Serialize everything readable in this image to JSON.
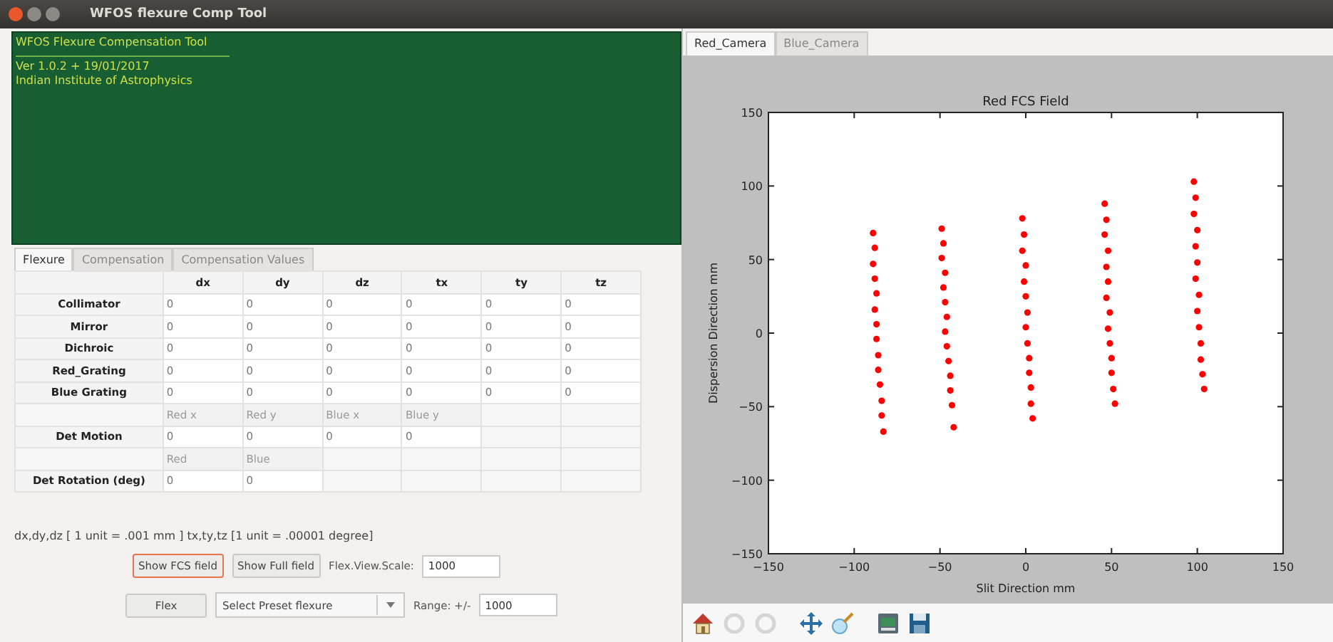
{
  "window": {
    "title": "WFOS flexure Comp Tool",
    "controls": [
      {
        "kind": "close"
      },
      {
        "kind": "minimize"
      },
      {
        "kind": "maximize"
      }
    ]
  },
  "banner": {
    "title": "WFOS Flexure Compensation Tool",
    "lines": [
      "Ver 1.0.2 + 19/01/2017",
      "Indian Institute of Astrophysics"
    ]
  },
  "left_tabs": [
    {
      "label": "Flexure",
      "selected": true
    },
    {
      "label": "Compensation",
      "selected": false
    },
    {
      "label": "Compensation Values",
      "selected": false
    }
  ],
  "table": {
    "columns": [
      "dx",
      "dy",
      "dz",
      "tx",
      "ty",
      "tz"
    ],
    "rows": [
      {
        "kind": "data",
        "label": "Collimator",
        "cells": [
          "0",
          "0",
          "0",
          "0",
          "0",
          "0"
        ]
      },
      {
        "kind": "data",
        "label": "Mirror",
        "cells": [
          "0",
          "0",
          "0",
          "0",
          "0",
          "0"
        ]
      },
      {
        "kind": "data",
        "label": "Dichroic",
        "cells": [
          "0",
          "0",
          "0",
          "0",
          "0",
          "0"
        ]
      },
      {
        "kind": "data",
        "label": "Red_Grating",
        "cells": [
          "0",
          "0",
          "0",
          "0",
          "0",
          "0"
        ]
      },
      {
        "kind": "data",
        "label": "Blue Grating",
        "cells": [
          "0",
          "0",
          "0",
          "0",
          "0",
          "0"
        ]
      },
      {
        "kind": "subheader",
        "cells": [
          "Red x",
          "Red y",
          "Blue x",
          "Blue y"
        ]
      },
      {
        "kind": "data",
        "label": "Det Motion",
        "cells": [
          "0",
          "0",
          "0",
          "0"
        ]
      },
      {
        "kind": "subheader",
        "cells": [
          "Red",
          "Blue"
        ]
      },
      {
        "kind": "data",
        "label": "Det Rotation (deg)",
        "cells": [
          "0",
          "0"
        ]
      }
    ]
  },
  "units_note": "dx,dy,dz  [ 1 unit = .001 mm ]  tx,ty,tz [1 unit = .00001 degree]",
  "controls_row1": {
    "buttons": [
      {
        "label": "Show FCS field",
        "focused": true
      },
      {
        "label": "Show Full field",
        "focused": false
      }
    ],
    "scale_label": "Flex.View.Scale:",
    "scale_value": "1000"
  },
  "controls_row2": {
    "button": "Flex",
    "preset": "Select Preset flexure",
    "range_label": "Range: +/-",
    "range_value": "1000"
  },
  "right_tabs": [
    {
      "label": "Red_Camera",
      "selected": true
    },
    {
      "label": "Blue_Camera",
      "selected": false
    }
  ],
  "plot": {
    "chart_data": {
      "type": "scatter",
      "title": "Red FCS Field",
      "xlabel": "Slit Direction mm",
      "ylabel": "Dispersion Direction mm",
      "xlim": [
        -150,
        150
      ],
      "ylim": [
        -150,
        150
      ],
      "xticks": [
        {
          "value": -150,
          "label": "−150"
        },
        {
          "value": -100,
          "label": "−100"
        },
        {
          "value": -50,
          "label": "−50"
        },
        0,
        50,
        100,
        150
      ],
      "yticks": [
        {
          "value": -150,
          "label": "−150"
        },
        {
          "value": -100,
          "label": "−100"
        },
        {
          "value": -50,
          "label": "−50"
        },
        0,
        50,
        100,
        150
      ],
      "series": [
        {
          "color": "#ff0000",
          "x": [
            -89,
            -88,
            -89,
            -88,
            -87,
            -88,
            -87,
            -87,
            -86,
            -86,
            -85,
            -84,
            -84,
            -83,
            -49,
            -48,
            -49,
            -47,
            -48,
            -47,
            -46,
            -47,
            -46,
            -45,
            -44,
            -44,
            -43,
            -42,
            -2,
            -1,
            -2,
            0,
            -1,
            0,
            1,
            0,
            1,
            2,
            2,
            3,
            3,
            4,
            46,
            47,
            46,
            48,
            47,
            48,
            47,
            49,
            48,
            49,
            50,
            50,
            51,
            52,
            98,
            99,
            98,
            100,
            99,
            100,
            99,
            101,
            100,
            101,
            102,
            102,
            103,
            104
          ],
          "values": [
            68,
            58,
            47,
            37,
            27,
            16,
            6,
            -4,
            -15,
            -25,
            -35,
            -46,
            -56,
            -67,
            71,
            61,
            51,
            41,
            31,
            21,
            11,
            1,
            -9,
            -19,
            -29,
            -39,
            -49,
            -64,
            78,
            67,
            56,
            46,
            35,
            25,
            14,
            4,
            -7,
            -17,
            -27,
            -37,
            -48,
            -58,
            88,
            77,
            67,
            56,
            45,
            35,
            24,
            14,
            3,
            -7,
            -17,
            -27,
            -38,
            -48,
            103,
            92,
            81,
            70,
            59,
            48,
            37,
            26,
            15,
            4,
            -7,
            -18,
            -28,
            -38
          ]
        }
      ]
    }
  },
  "toolbar": [
    {
      "kind": "home",
      "disabled": false
    },
    {
      "kind": "back",
      "disabled": true
    },
    {
      "kind": "forward",
      "disabled": true
    },
    {
      "kind": "move",
      "disabled": false
    },
    {
      "kind": "zoom",
      "disabled": false
    },
    {
      "kind": "configure",
      "disabled": false
    },
    {
      "kind": "save",
      "disabled": false
    }
  ]
}
